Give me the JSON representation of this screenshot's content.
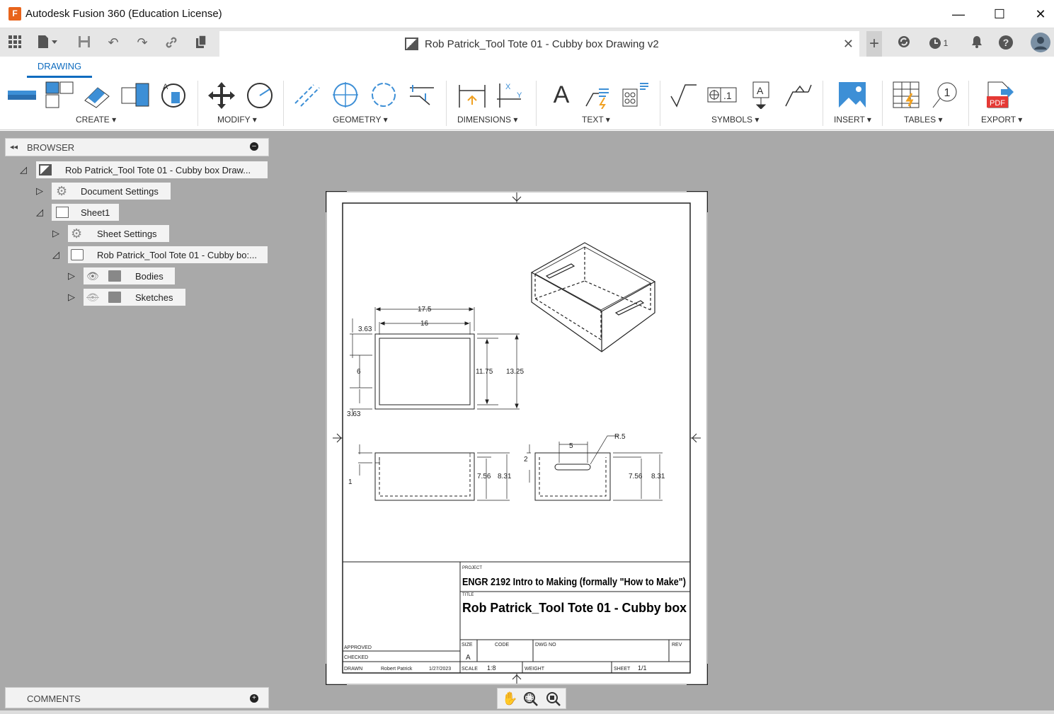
{
  "window": {
    "title": "Autodesk Fusion 360 (Education License)",
    "app_icon_letter": "F",
    "minimize": "—",
    "maximize": "☐",
    "close": "✕"
  },
  "tabbar": {
    "doc_title": "Rob Patrick_Tool Tote 01 - Cubby box Drawing v2",
    "close": "✕",
    "plus": "+",
    "jobs_count": "1"
  },
  "ribbon": {
    "active_tab": "DRAWING",
    "groups": [
      "CREATE ▾",
      "MODIFY ▾",
      "GEOMETRY ▾",
      "DIMENSIONS ▾",
      "TEXT ▾",
      "SYMBOLS ▾",
      "INSERT ▾",
      "TABLES ▾",
      "EXPORT ▾"
    ]
  },
  "browser": {
    "label": "BROWSER",
    "collapse": "◂◂",
    "items": [
      {
        "label": "Rob Patrick_Tool Tote 01 - Cubby box Draw..."
      },
      {
        "label": "Document Settings"
      },
      {
        "label": "Sheet1"
      },
      {
        "label": "Sheet Settings"
      },
      {
        "label": "Rob Patrick_Tool Tote 01 - Cubby bo:..."
      },
      {
        "label": "Bodies"
      },
      {
        "label": "Sketches"
      }
    ]
  },
  "comments": {
    "label": "COMMENTS"
  },
  "drawing": {
    "dims": {
      "w_outer": "17.5",
      "w_inner": "16",
      "top_off": "3.63",
      "mid": "6",
      "bot_off": "3.63",
      "h_inner": "11.75",
      "h_outer": "13.25",
      "front_step": "1",
      "front_h_in": "7.56",
      "front_h_out": "8.31",
      "slot_len": "5",
      "slot_r": "R.5",
      "slot_off": "2",
      "side_h_in": "7.56",
      "side_h_out": "8.31"
    },
    "titleblock": {
      "project_lbl": "PROJECT",
      "project": "ENGR 2192 Intro to Making (formally \"How to Make\")",
      "title_lbl": "TITLE",
      "title": "Rob Patrick_Tool Tote 01 - Cubby box",
      "approved": "APPROVED",
      "checked": "CHECKED",
      "drawn": "DRAWN",
      "drawn_by": "Robert Patrick",
      "drawn_date": "1/27/2023",
      "size_lbl": "SIZE",
      "size": "A",
      "code_lbl": "CODE",
      "dwgno_lbl": "DWG NO",
      "rev_lbl": "REV",
      "scale_lbl": "SCALE",
      "scale": "1:8",
      "weight_lbl": "WEIGHT",
      "sheet_lbl": "SHEET",
      "sheet": "1/1"
    }
  }
}
